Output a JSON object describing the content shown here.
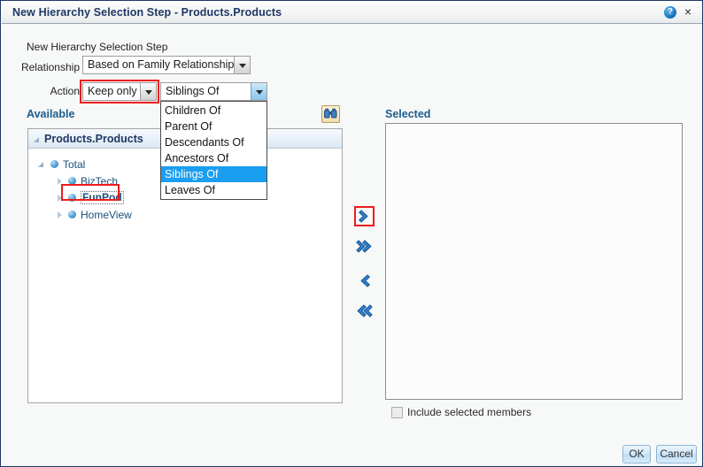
{
  "window": {
    "title": "New Hierarchy Selection Step - Products.Products",
    "help_icon": "help-icon",
    "help_glyph": "?",
    "close_icon": "close-icon",
    "close_glyph": "×"
  },
  "form": {
    "caption": "New Hierarchy Selection Step",
    "relationship_label": "Relationship",
    "relationship_value": "Based on Family Relationship",
    "action_label": "Action",
    "action_value": "Keep only",
    "family_value": "Siblings Of"
  },
  "dropdown": {
    "open": true,
    "options": [
      "Children Of",
      "Parent Of",
      "Descendants Of",
      "Ancestors Of",
      "Siblings Of",
      "Leaves Of"
    ],
    "selected": "Siblings Of",
    "selected_index": 4
  },
  "available": {
    "section_label": "Available",
    "search_icon": "binoculars-search-icon",
    "panel_title": "Products.Products",
    "tree": [
      {
        "label": "Total",
        "indent": 0,
        "state": "expanded",
        "bold": false
      },
      {
        "label": "BizTech",
        "indent": 1,
        "state": "collapsed",
        "bold": false
      },
      {
        "label": "FunPod",
        "indent": 1,
        "state": "collapsed",
        "bold": true
      },
      {
        "label": "HomeView",
        "indent": 1,
        "state": "collapsed",
        "bold": false
      }
    ]
  },
  "transfer_buttons": [
    {
      "name": "move-right-icon",
      "glyph": "single-right",
      "highlighted": true
    },
    {
      "name": "move-all-right-icon",
      "glyph": "double-right",
      "highlighted": false
    },
    {
      "name": "move-left-icon",
      "glyph": "single-left",
      "highlighted": false
    },
    {
      "name": "move-all-left-icon",
      "glyph": "double-left",
      "highlighted": false
    }
  ],
  "selected": {
    "section_label": "Selected",
    "items": []
  },
  "include_members": {
    "label": "Include selected members",
    "checked": false
  },
  "footer": {
    "ok_label": "OK",
    "cancel_label": "Cancel"
  },
  "colors": {
    "title_text": "#1f3864",
    "section_label": "#1b5d8e",
    "highlight_red": "#ee1c1c",
    "dropdown_selected_bg": "#1a9ef0",
    "tree_text": "#1a4f7a"
  }
}
